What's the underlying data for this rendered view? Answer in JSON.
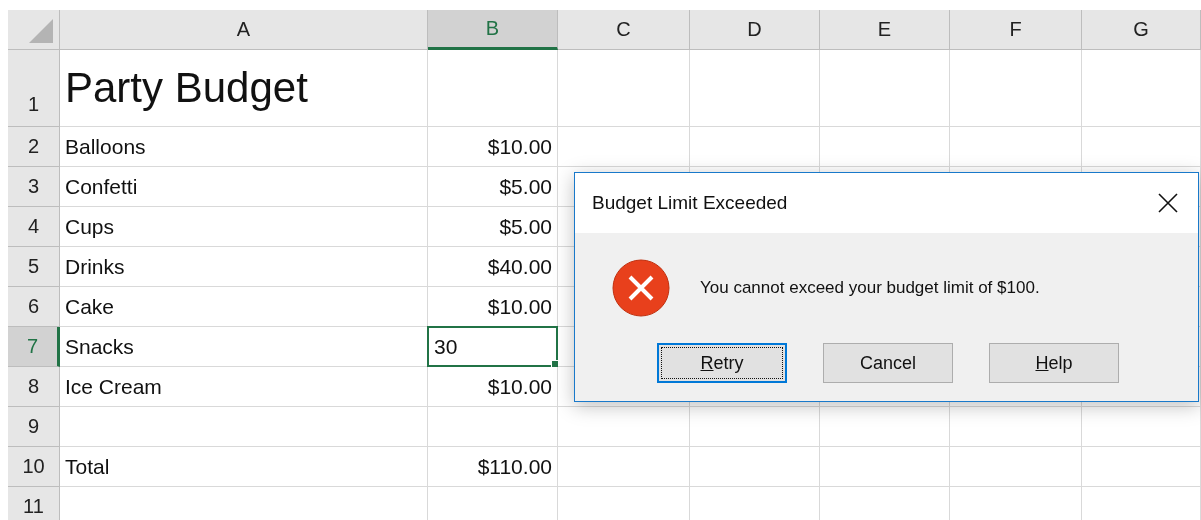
{
  "sheet": {
    "columns": [
      {
        "label": "A",
        "selected": false
      },
      {
        "label": "B",
        "selected": true
      },
      {
        "label": "C",
        "selected": false
      },
      {
        "label": "D",
        "selected": false
      },
      {
        "label": "E",
        "selected": false
      },
      {
        "label": "F",
        "selected": false
      },
      {
        "label": "G",
        "selected": false
      }
    ],
    "rows": [
      {
        "label": "1",
        "selected": false,
        "kind": "title",
        "item": "Party Budget",
        "amount_selected": false
      },
      {
        "label": "2",
        "selected": false,
        "kind": "line",
        "item": "Balloons",
        "amount": "$10.00",
        "amount_selected": false
      },
      {
        "label": "3",
        "selected": false,
        "kind": "line",
        "item": "Confetti",
        "amount": "$5.00",
        "amount_selected": false
      },
      {
        "label": "4",
        "selected": false,
        "kind": "line",
        "item": "Cups",
        "amount": "$5.00",
        "amount_selected": false
      },
      {
        "label": "5",
        "selected": false,
        "kind": "line",
        "item": "Drinks",
        "amount": "$40.00",
        "amount_selected": false
      },
      {
        "label": "6",
        "selected": false,
        "kind": "line",
        "item": "Cake",
        "amount": "$10.00",
        "amount_selected": false
      },
      {
        "label": "7",
        "selected": true,
        "kind": "line",
        "item": "Snacks",
        "amount": "30",
        "amount_selected": true
      },
      {
        "label": "8",
        "selected": false,
        "kind": "line",
        "item": "Ice Cream",
        "amount": "$10.00",
        "amount_selected": false
      },
      {
        "label": "9",
        "selected": false,
        "kind": "line",
        "amount_selected": false
      },
      {
        "label": "10",
        "selected": false,
        "kind": "line",
        "item": "Total",
        "amount": "$110.00",
        "amount_selected": false
      },
      {
        "label": "11",
        "selected": false,
        "kind": "line",
        "amount_selected": false
      }
    ]
  },
  "dialog": {
    "title": "Budget Limit Exceeded",
    "message": "You cannot exceed your budget limit of $100.",
    "buttons": [
      {
        "label": "Retry",
        "default": true,
        "mnemonic": true
      },
      {
        "label": "Cancel",
        "default": false,
        "mnemonic": false
      },
      {
        "label": "Help",
        "default": false,
        "mnemonic": true
      }
    ]
  }
}
